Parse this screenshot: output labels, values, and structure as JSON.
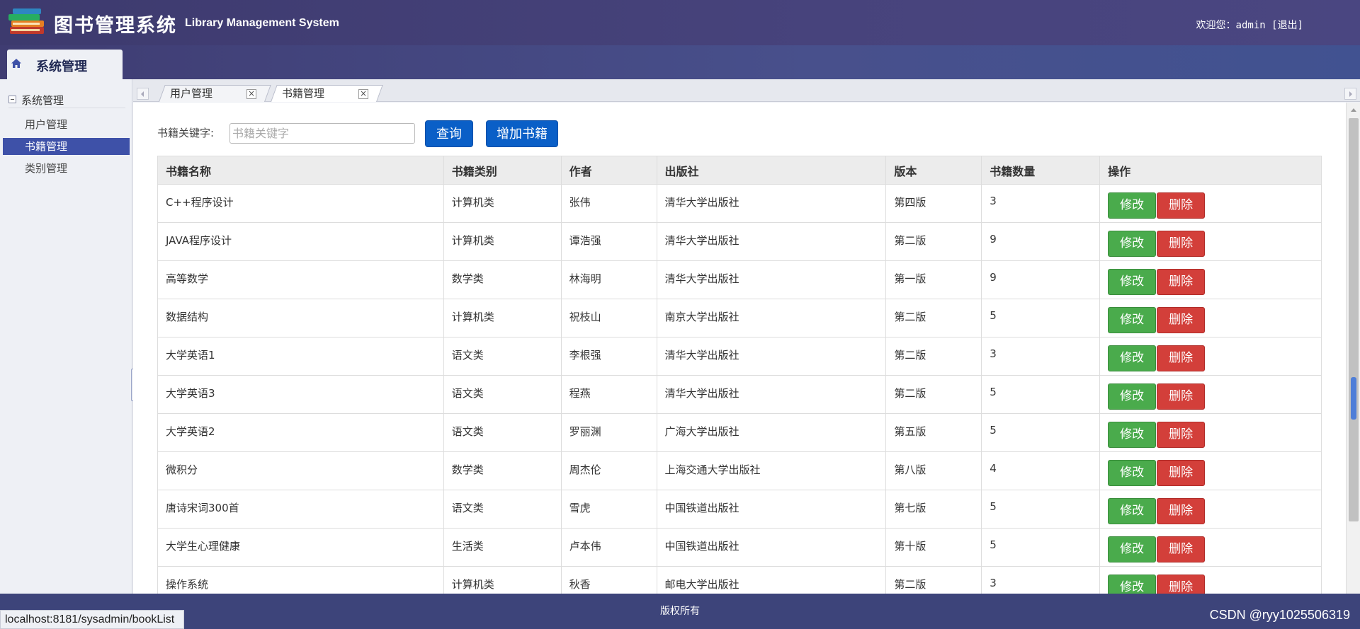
{
  "header": {
    "title": "图书管理系统",
    "subtitle": "Library Management System",
    "welcome_prefix": "欢迎您：",
    "username": "admin",
    "logout": "[退出]"
  },
  "navbar": {
    "tab_label": "系统管理"
  },
  "sidebar": {
    "group_label": "系统管理",
    "items": [
      {
        "label": "用户管理"
      },
      {
        "label": "书籍管理"
      },
      {
        "label": "类别管理"
      }
    ]
  },
  "tabs": [
    {
      "label": "用户管理",
      "close": "×"
    },
    {
      "label": "书籍管理",
      "close": "×"
    }
  ],
  "search": {
    "label": "书籍关键字:",
    "placeholder": "书籍关键字",
    "query_button": "查询",
    "add_button": "增加书籍"
  },
  "table": {
    "headers": [
      "书籍名称",
      "书籍类别",
      "作者",
      "出版社",
      "版本",
      "书籍数量",
      "操作"
    ],
    "edit_label": "修改",
    "delete_label": "删除",
    "rows": [
      {
        "name": "C++程序设计",
        "category": "计算机类",
        "author": "张伟",
        "publisher": "清华大学出版社",
        "edition": "第四版",
        "count": "3"
      },
      {
        "name": "JAVA程序设计",
        "category": "计算机类",
        "author": "谭浩强",
        "publisher": "清华大学出版社",
        "edition": "第二版",
        "count": "9"
      },
      {
        "name": "高等数学",
        "category": "数学类",
        "author": "林海明",
        "publisher": "清华大学出版社",
        "edition": "第一版",
        "count": "9"
      },
      {
        "name": "数据结构",
        "category": "计算机类",
        "author": "祝枝山",
        "publisher": "南京大学出版社",
        "edition": "第二版",
        "count": "5"
      },
      {
        "name": "大学英语1",
        "category": "语文类",
        "author": "李根强",
        "publisher": "清华大学出版社",
        "edition": "第二版",
        "count": "3"
      },
      {
        "name": "大学英语3",
        "category": "语文类",
        "author": "程燕",
        "publisher": "清华大学出版社",
        "edition": "第二版",
        "count": "5"
      },
      {
        "name": "大学英语2",
        "category": "语文类",
        "author": "罗丽渊",
        "publisher": "广海大学出版社",
        "edition": "第五版",
        "count": "5"
      },
      {
        "name": "微积分",
        "category": "数学类",
        "author": "周杰伦",
        "publisher": "上海交通大学出版社",
        "edition": "第八版",
        "count": "4"
      },
      {
        "name": "唐诗宋词300首",
        "category": "语文类",
        "author": "雪虎",
        "publisher": "中国铁道出版社",
        "edition": "第七版",
        "count": "5"
      },
      {
        "name": "大学生心理健康",
        "category": "生活类",
        "author": "卢本伟",
        "publisher": "中国铁道出版社",
        "edition": "第十版",
        "count": "5"
      },
      {
        "name": "操作系统",
        "category": "计算机类",
        "author": "秋香",
        "publisher": "邮电大学出版社",
        "edition": "第二版",
        "count": "3"
      }
    ]
  },
  "footer": {
    "copyright": "版权所有",
    "status_url": "localhost:8181/sysadmin/bookList",
    "watermark": "CSDN @ryy1025506319"
  },
  "colors": {
    "header_bg": "#3d3a6e",
    "accent_blue": "#0a5fc7",
    "sidebar_active": "#3e51a8",
    "edit_green": "#4aab4c",
    "delete_red": "#d33f3a"
  },
  "icons": {
    "logo": "books-logo-icon",
    "home": "home-icon",
    "group_toggle": "collapse-toggle-icon",
    "tab_close": "close-icon"
  }
}
